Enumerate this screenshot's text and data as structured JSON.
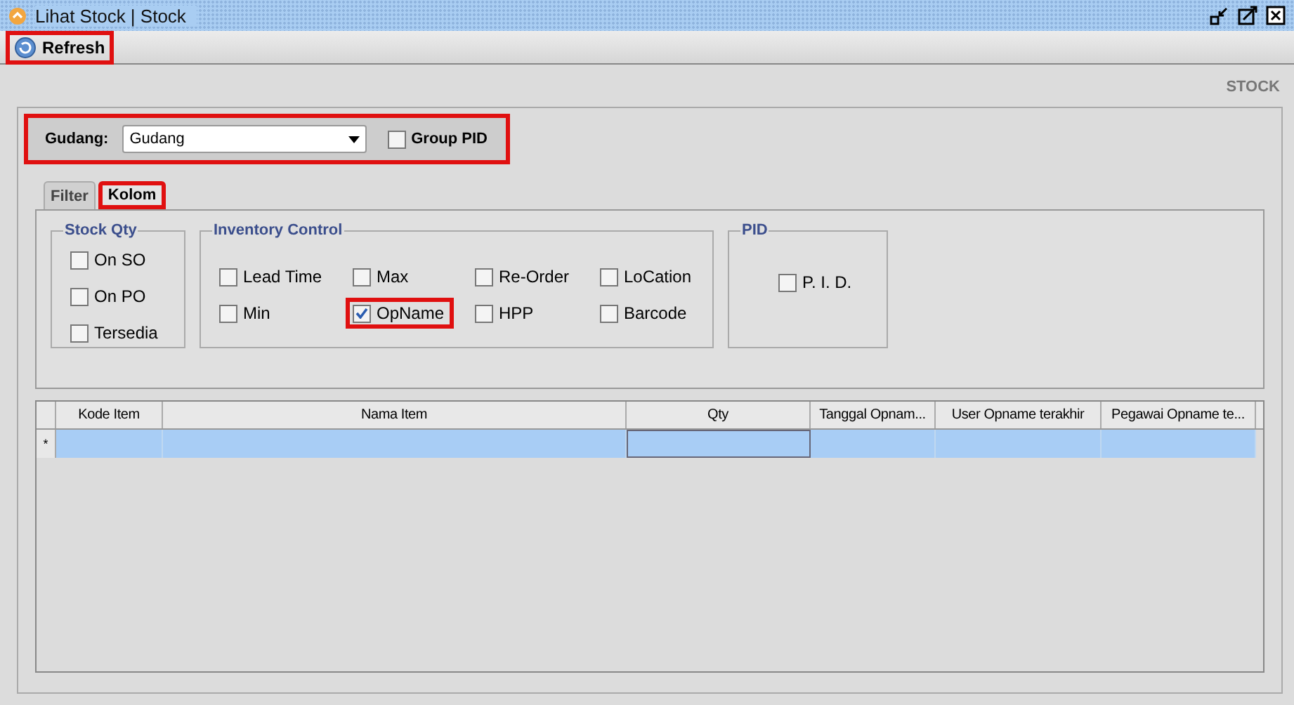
{
  "window": {
    "title": "Lihat Stock | Stock"
  },
  "toolbar": {
    "refresh": {
      "label": "Refresh",
      "highlighted": true
    }
  },
  "section_title": "STOCK",
  "gudang": {
    "label": "Gudang:",
    "value": "Gudang",
    "group_pid": {
      "label": "Group PID",
      "checked": false
    },
    "highlighted": true
  },
  "tabs": [
    {
      "label": "Filter",
      "selected": false,
      "highlighted": false
    },
    {
      "label": "Kolom",
      "selected": true,
      "highlighted": true
    }
  ],
  "groups": [
    {
      "title": "Stock Qty",
      "items": [
        {
          "label": "On SO",
          "checked": false,
          "highlighted": false
        },
        {
          "label": "On PO",
          "checked": false,
          "highlighted": false
        },
        {
          "label": "Tersedia",
          "checked": false,
          "highlighted": false
        }
      ]
    },
    {
      "title": "Inventory Control",
      "items": [
        {
          "label": "Lead Time",
          "checked": false,
          "highlighted": false
        },
        {
          "label": "Max",
          "checked": false,
          "highlighted": false
        },
        {
          "label": "Re-Order",
          "checked": false,
          "highlighted": false
        },
        {
          "label": "LoCation",
          "checked": false,
          "highlighted": false
        },
        {
          "label": "Min",
          "checked": false,
          "highlighted": false
        },
        {
          "label": "OpName",
          "checked": true,
          "highlighted": true
        },
        {
          "label": "HPP",
          "checked": false,
          "highlighted": false
        },
        {
          "label": "Barcode",
          "checked": false,
          "highlighted": false
        }
      ]
    },
    {
      "title": "PID",
      "items": [
        {
          "label": "P. I. D.",
          "checked": false,
          "highlighted": false
        }
      ]
    }
  ],
  "table": {
    "columns": [
      "Kode Item",
      "Nama Item",
      "Qty",
      "Tanggal Opnam...",
      "User Opname terakhir",
      "Pegawai Opname te..."
    ],
    "row_marker": "*"
  }
}
